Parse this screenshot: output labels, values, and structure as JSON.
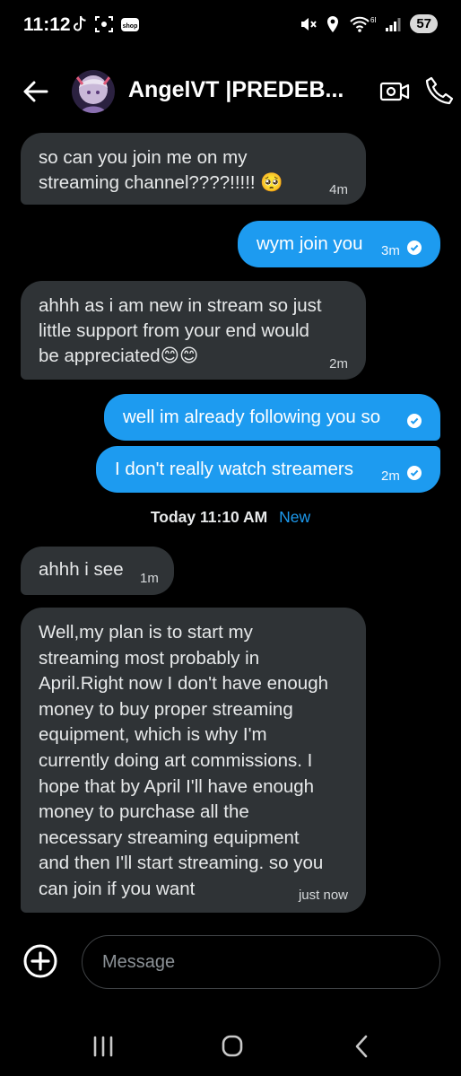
{
  "status_bar": {
    "time": "11:12",
    "battery": "57",
    "network": "6E"
  },
  "header": {
    "contact_name": "AngelVT |PREDEB..."
  },
  "messages": [
    {
      "text": "so can you join me on my\nstreaming channel????!!!!! 🥺",
      "time": "4m"
    },
    {
      "text": "wym join you",
      "time": "3m"
    },
    {
      "text": "ahhh as i am new in stream so just\nlittle support from your end would\nbe appreciated😊😊",
      "time": "2m"
    },
    {
      "text": "well im already following you so",
      "time": ""
    },
    {
      "text": "I don't really watch streamers",
      "time": "2m"
    },
    {
      "text": "ahhh i see",
      "time": "1m"
    },
    {
      "text": "Well,my plan is to start my\nstreaming most probably in\nApril.Right now I don't have enough\nmoney to buy proper streaming\nequipment, which is why I'm\ncurrently doing art commissions. I\nhope that by April I'll have enough\nmoney to purchase all the\nnecessary streaming equipment\nand then I'll start streaming. so you\ncan join if you want",
      "time": "just now"
    }
  ],
  "divider": {
    "time": "Today 11:10 AM",
    "new_label": "New"
  },
  "composer": {
    "placeholder": "Message"
  },
  "colors": {
    "accent": "#1d9bf0",
    "received_bubble": "#2f3336",
    "background": "#000000"
  }
}
